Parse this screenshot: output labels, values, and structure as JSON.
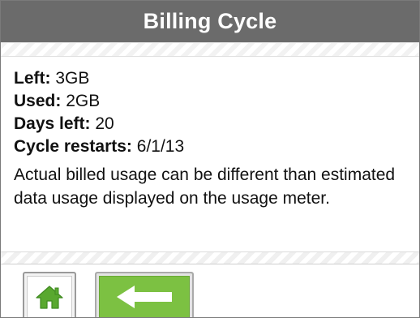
{
  "header": {
    "title": "Billing Cycle"
  },
  "stats": [
    {
      "label": "Left:",
      "value": "3GB"
    },
    {
      "label": "Used:",
      "value": "2GB"
    },
    {
      "label": "Days left:",
      "value": "20"
    },
    {
      "label": "Cycle restarts:",
      "value": "6/1/13"
    }
  ],
  "note": "Actual billed usage can be different than estimated data usage displayed on the usage meter.",
  "footer": {
    "home_icon": "home-icon",
    "back_icon": "arrow-left-icon"
  },
  "colors": {
    "header_bg": "#6b6b6b",
    "header_text": "#ffffff",
    "accent_green": "#7cc142"
  }
}
